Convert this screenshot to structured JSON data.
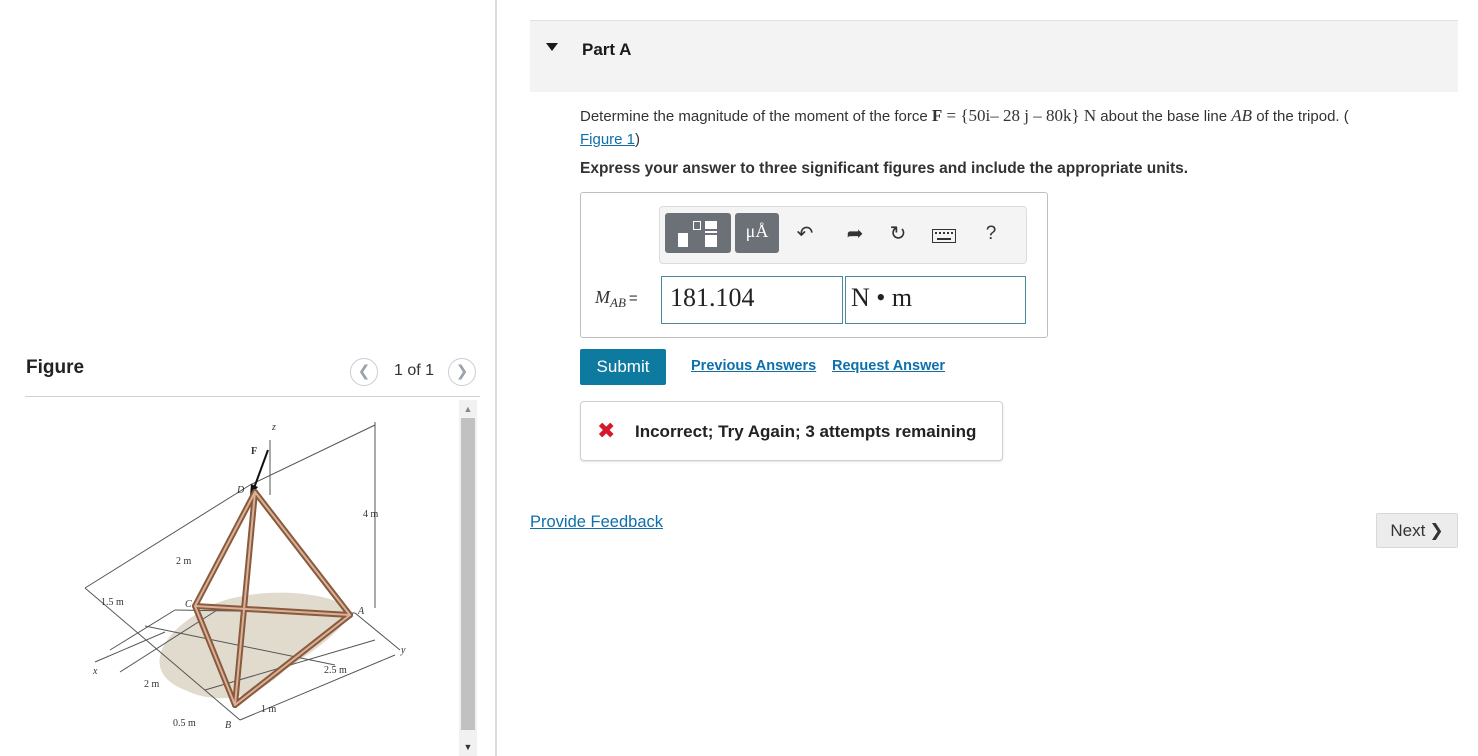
{
  "figure_panel": {
    "title": "Figure",
    "page_count": "1 of 1",
    "prev_icon": "chevron-left-icon",
    "next_icon": "chevron-right-icon",
    "diagram_labels": {
      "z": "z",
      "F": "F",
      "D": "D",
      "C": "C",
      "A": "A",
      "B": "B",
      "x": "x",
      "y": "y",
      "dim_4m": "4 m",
      "dim_2m_top": "2 m",
      "dim_1_5m": "1.5 m",
      "dim_2m_bottom": "2 m",
      "dim_0_5m": "0.5 m",
      "dim_1m": "1 m",
      "dim_2_5m": "2.5 m"
    }
  },
  "part": {
    "title": "Part A",
    "question_prefix": "Determine the magnitude of the moment of the force ",
    "force_symbol": "F",
    "force_expression": " = {50i– 28 j – 80k} N",
    "question_mid": " about the base line ",
    "line_symbol": "AB",
    "question_suffix": " of the tripod. (",
    "figure_link": "Figure 1",
    "close_paren": ")",
    "instructions": "Express your answer to three significant figures and include the appropriate units."
  },
  "answer": {
    "variable": "M",
    "variable_sub": "AB",
    "equals": "=",
    "value": "181.104",
    "unit": "N • m",
    "units_button": "μÅ",
    "toolbar_icons": [
      "templates-icon",
      "units-icon",
      "undo-icon",
      "redo-icon",
      "reset-icon",
      "keyboard-icon",
      "help-icon"
    ],
    "help_label": "?"
  },
  "actions": {
    "submit": "Submit",
    "previous_answers": "Previous Answers",
    "request_answer": "Request Answer"
  },
  "feedback": {
    "icon": "x-icon",
    "message": "Incorrect; Try Again; 3 attempts remaining"
  },
  "footer": {
    "provide_feedback": "Provide Feedback",
    "next": "Next"
  },
  "colors": {
    "accent_blue": "#0f7aa0",
    "link_blue": "#0e6fab",
    "error_red": "#d3192a"
  }
}
